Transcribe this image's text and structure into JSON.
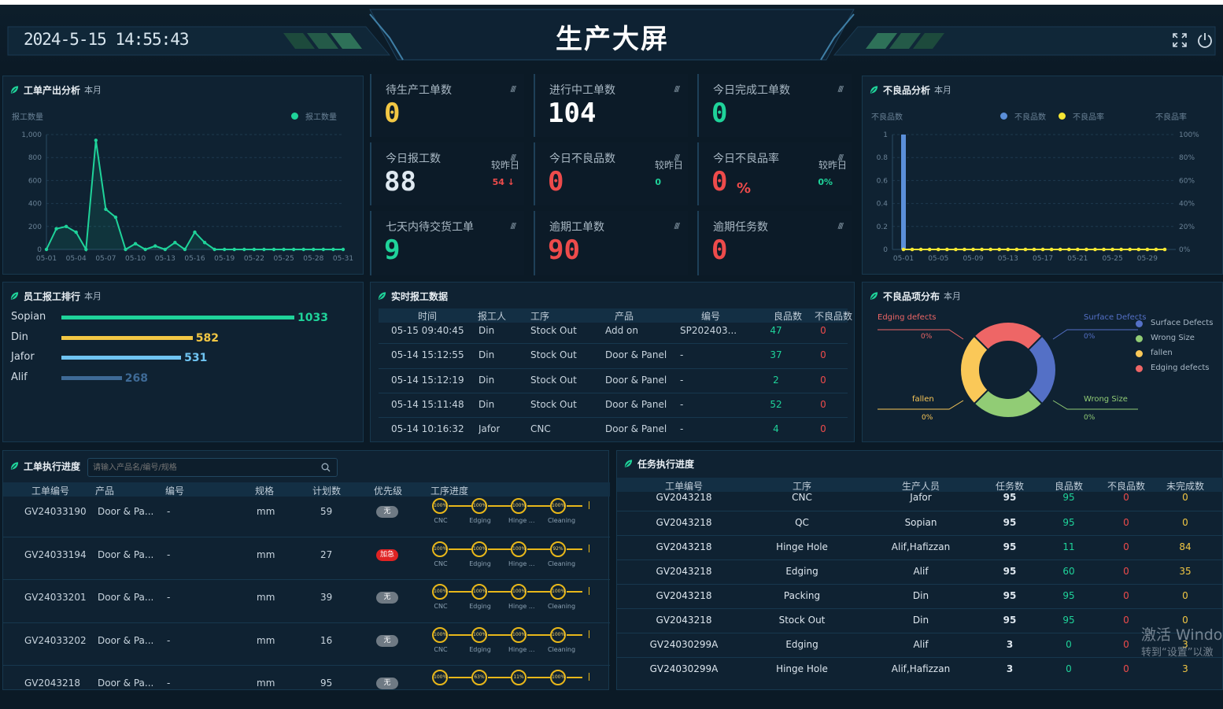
{
  "header": {
    "datetime": "2024-5-15 14:55:43",
    "title": "生产大屏",
    "icons": [
      "fullscreen-icon",
      "power-icon"
    ]
  },
  "workorder_output": {
    "title": "工单产出分析",
    "period": "本月",
    "ylabel": "报工数量",
    "legend": "报工数量"
  },
  "kpis": {
    "pending": {
      "label": "待生产工单数",
      "value": "0"
    },
    "in_progress": {
      "label": "进行中工单数",
      "value": "104"
    },
    "completed_today": {
      "label": "今日完成工单数",
      "value": "0"
    },
    "reported_today": {
      "label": "今日报工数",
      "value": "88",
      "compare_label": "较昨日",
      "compare_value": "54 ↓"
    },
    "defects_today": {
      "label": "今日不良品数",
      "value": "0",
      "compare_label": "较昨日",
      "compare_value": "0"
    },
    "defect_rate_today": {
      "label": "今日不良品率",
      "value": "0",
      "unit": "%",
      "compare_label": "较昨日",
      "compare_value": "0%"
    },
    "due_7days": {
      "label": "七天内待交货工单",
      "value": "9"
    },
    "overdue_orders": {
      "label": "逾期工单数",
      "value": "90"
    },
    "overdue_tasks": {
      "label": "逾期任务数",
      "value": "0"
    }
  },
  "defect_analysis": {
    "title": "不良品分析",
    "period": "本月",
    "ylabel_left": "不良品数",
    "ylabel_right": "不良品率",
    "legend": [
      "不良品数",
      "不良品率"
    ]
  },
  "employee_rank": {
    "title": "员工报工排行",
    "period": "本月",
    "items": [
      {
        "name": "Sopian",
        "value": "1033",
        "color": "#1fd39a"
      },
      {
        "name": "Din",
        "value": "582",
        "color": "#f2c744"
      },
      {
        "name": "Jafor",
        "value": "531",
        "color": "#6fc4f2"
      },
      {
        "name": "Alif",
        "value": "268",
        "color": "#3e6a96"
      }
    ]
  },
  "realtime": {
    "title": "实时报工数据",
    "columns": [
      "时间",
      "报工人",
      "工序",
      "产品",
      "编号",
      "良品数",
      "不良品数"
    ],
    "rows": [
      [
        "05-15 09:40:45",
        "Din",
        "Stock Out",
        "Add on",
        "SP202403...",
        "47",
        "0"
      ],
      [
        "05-14 15:12:55",
        "Din",
        "Stock Out",
        "Door & Panel",
        "-",
        "37",
        "0"
      ],
      [
        "05-14 15:12:19",
        "Din",
        "Stock Out",
        "Door & Panel",
        "-",
        "2",
        "0"
      ],
      [
        "05-14 15:11:48",
        "Din",
        "Stock Out",
        "Door & Panel",
        "-",
        "52",
        "0"
      ],
      [
        "05-14 10:16:32",
        "Jafor",
        "CNC",
        "Door & Panel",
        "-",
        "4",
        "0"
      ]
    ]
  },
  "defect_dist": {
    "title": "不良品项分布",
    "period": "本月",
    "legend": [
      {
        "name": "Surface Defects",
        "color": "#5470c6"
      },
      {
        "name": "Wrong Size",
        "color": "#91cc75"
      },
      {
        "name": "fallen",
        "color": "#fac858"
      },
      {
        "name": "Edging defects",
        "color": "#ee6666"
      }
    ],
    "callouts": {
      "edging": {
        "label": "Edging defects",
        "pct": "0%"
      },
      "surface": {
        "label": "Surface Defects",
        "pct": "0%"
      },
      "fallen": {
        "label": "fallen",
        "pct": "0%"
      },
      "wrong": {
        "label": "Wrong Size",
        "pct": "0%"
      }
    }
  },
  "workorder_progress": {
    "title": "工单执行进度",
    "search_placeholder": "请输入产品名/编号/规格",
    "columns": [
      "工单编号",
      "产品",
      "编号",
      "规格",
      "计划数",
      "优先级",
      "工序进度"
    ],
    "steps": [
      "CNC",
      "Edging",
      "Hinge ...",
      "Cleaning"
    ],
    "rows": [
      {
        "id": "GV24033190",
        "product": "Door & Pa...",
        "code": "-",
        "spec": "mm",
        "plan": "59",
        "priority": "无",
        "urgent": false,
        "pcts": [
          "100%",
          "100%",
          "100%",
          "100%"
        ],
        "labels": true
      },
      {
        "id": "GV24033194",
        "product": "Door & Pa...",
        "code": "-",
        "spec": "mm",
        "plan": "27",
        "priority": "加急",
        "urgent": true,
        "pcts": [
          "100%",
          "100%",
          "100%",
          "92%"
        ],
        "labels": true
      },
      {
        "id": "GV24033201",
        "product": "Door & Pa...",
        "code": "-",
        "spec": "mm",
        "plan": "39",
        "priority": "无",
        "urgent": false,
        "pcts": [
          "100%",
          "100%",
          "100%",
          "100%"
        ],
        "labels": true
      },
      {
        "id": "GV24033202",
        "product": "Door & Pa...",
        "code": "-",
        "spec": "mm",
        "plan": "16",
        "priority": "无",
        "urgent": false,
        "pcts": [
          "100%",
          "100%",
          "100%",
          "100%"
        ],
        "labels": true
      },
      {
        "id": "GV2043218",
        "product": "Door & Pa...",
        "code": "-",
        "spec": "mm",
        "plan": "95",
        "priority": "无",
        "urgent": false,
        "pcts": [
          "100%",
          "63%",
          "11%",
          "100%"
        ],
        "labels": false
      }
    ]
  },
  "task_progress": {
    "title": "任务执行进度",
    "columns": [
      "工单编号",
      "工序",
      "生产人员",
      "任务数",
      "良品数",
      "不良品数",
      "未完成数"
    ],
    "rows": [
      [
        "GV2043218",
        "CNC",
        "Jafor",
        "95",
        "95",
        "0",
        "0"
      ],
      [
        "GV2043218",
        "QC",
        "Sopian",
        "95",
        "95",
        "0",
        "0"
      ],
      [
        "GV2043218",
        "Hinge Hole",
        "Alif,Hafizzan",
        "95",
        "11",
        "0",
        "84"
      ],
      [
        "GV2043218",
        "Edging",
        "Alif",
        "95",
        "60",
        "0",
        "35"
      ],
      [
        "GV2043218",
        "Packing",
        "Din",
        "95",
        "95",
        "0",
        "0"
      ],
      [
        "GV2043218",
        "Stock Out",
        "Din",
        "95",
        "95",
        "0",
        "0"
      ],
      [
        "GV24030299A",
        "Edging",
        "Alif",
        "3",
        "0",
        "0",
        "3"
      ],
      [
        "GV24030299A",
        "Hinge Hole",
        "Alif,Hafizzan",
        "3",
        "0",
        "0",
        "3"
      ]
    ]
  },
  "watermark": {
    "line1": "激活 Windo",
    "line2": "转到“设置”以激"
  },
  "chart_data": [
    {
      "type": "line",
      "title": "工单产出分析",
      "ylabel": "报工数量",
      "series": [
        {
          "name": "报工数量",
          "values": [
            0,
            180,
            200,
            150,
            0,
            950,
            350,
            280,
            0,
            50,
            0,
            30,
            0,
            60,
            0,
            150,
            60,
            0,
            0,
            0,
            0,
            0,
            0,
            0,
            0,
            0,
            0,
            0,
            0,
            0,
            0
          ]
        }
      ],
      "x": [
        "05-01",
        "05-02",
        "05-03",
        "05-04",
        "05-05",
        "05-06",
        "05-07",
        "05-08",
        "05-09",
        "05-10",
        "05-11",
        "05-12",
        "05-13",
        "05-14",
        "05-15",
        "05-16",
        "05-17",
        "05-18",
        "05-19",
        "05-20",
        "05-21",
        "05-22",
        "05-23",
        "05-24",
        "05-25",
        "05-26",
        "05-27",
        "05-28",
        "05-29",
        "05-30",
        "05-31"
      ],
      "tick_labels": [
        "05-01",
        "05-04",
        "05-07",
        "05-10",
        "05-13",
        "05-16",
        "05-19",
        "05-22",
        "05-25",
        "05-28",
        "05-31"
      ],
      "yticks": [
        "0",
        "200",
        "400",
        "600",
        "800",
        "1,000"
      ],
      "ylim": [
        0,
        1000
      ],
      "grid": true,
      "color": "#1fd39a"
    },
    {
      "type": "bar",
      "title": "不良品分析",
      "x": [
        "05-01",
        "05-02",
        "05-03",
        "05-04",
        "05-05",
        "05-06",
        "05-07",
        "05-08",
        "05-09",
        "05-10",
        "05-11",
        "05-12",
        "05-13",
        "05-14",
        "05-15",
        "05-16",
        "05-17",
        "05-18",
        "05-19",
        "05-20",
        "05-21",
        "05-22",
        "05-23",
        "05-24",
        "05-25",
        "05-26",
        "05-27",
        "05-28",
        "05-29",
        "05-30",
        "05-31"
      ],
      "tick_labels": [
        "05-01",
        "05-05",
        "05-09",
        "05-13",
        "05-17",
        "05-21",
        "05-25",
        "05-29"
      ],
      "series": [
        {
          "name": "不良品数",
          "type": "bar",
          "color": "#5b8fd9",
          "values": [
            1,
            0,
            0,
            0,
            0,
            0,
            0,
            0,
            0,
            0,
            0,
            0,
            0,
            0,
            0,
            0,
            0,
            0,
            0,
            0,
            0,
            0,
            0,
            0,
            0,
            0,
            0,
            0,
            0,
            0,
            0
          ]
        },
        {
          "name": "不良品率",
          "type": "line",
          "color": "#f5e633",
          "values": [
            0,
            0,
            0,
            0,
            0,
            0,
            0,
            0,
            0,
            0,
            0,
            0,
            0,
            0,
            0,
            0,
            0,
            0,
            0,
            0,
            0,
            0,
            0,
            0,
            0,
            0,
            0,
            0,
            0,
            0,
            0
          ]
        }
      ],
      "yticks_left": [
        "0",
        "0.2",
        "0.4",
        "0.6",
        "0.8",
        "1"
      ],
      "yticks_right": [
        "0%",
        "20%",
        "40%",
        "60%",
        "80%",
        "100%"
      ],
      "ylim": [
        0,
        1
      ],
      "grid": true
    },
    {
      "type": "pie",
      "title": "不良品项分布",
      "categories": [
        "Surface Defects",
        "Wrong Size",
        "fallen",
        "Edging defects"
      ],
      "values": [
        25,
        25,
        25,
        25
      ],
      "colors": [
        "#5470c6",
        "#91cc75",
        "#fac858",
        "#ee6666"
      ]
    }
  ]
}
